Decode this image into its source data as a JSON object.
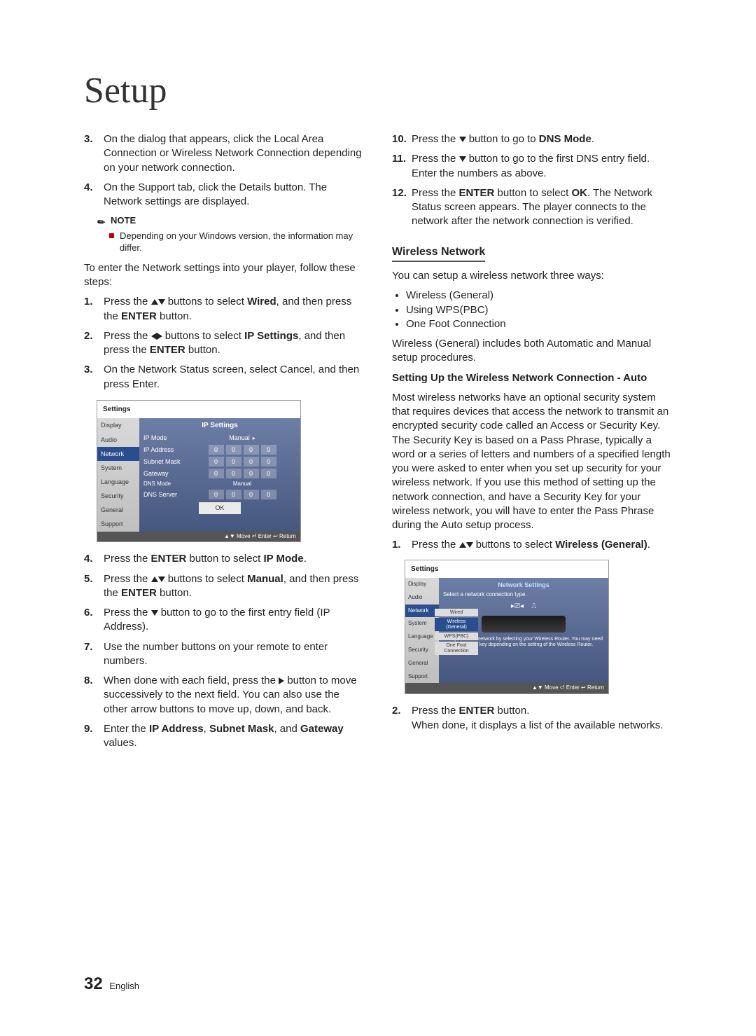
{
  "title": "Setup",
  "left": {
    "s3": "On the dialog that appears, click the Local Area Connection or Wireless Network Connection depending on your network connection.",
    "s4": "On the Support tab, click the Details button. The Network settings are displayed.",
    "noteLabel": "NOTE",
    "noteText": "Depending on your Windows version, the information may differ.",
    "intro": "To enter the Network settings into your player, follow these steps:",
    "st1a": "Press the ",
    "st1b": " buttons to select ",
    "st1c": ", and then press the ",
    "st1d": " button.",
    "wired": "Wired",
    "enter": "ENTER",
    "st2a": "Press the ",
    "st2b": " buttons to select ",
    "st2c": ", and then press the ",
    "st2d": " button.",
    "ipSettings": "IP Settings",
    "st3": "On the Network Status screen, select Cancel, and then press Enter.",
    "shot": {
      "title": "Settings",
      "side": [
        "Display",
        "Audio",
        "Network",
        "System",
        "Language",
        "Security",
        "General",
        "Support"
      ],
      "panelTitle": "IP Settings",
      "rows": {
        "ipMode": "IP Mode",
        "manual": "Manual",
        "ipAddr": "IP Address",
        "subnet": "Subnet Mask",
        "gateway": "Gateway",
        "dnsMode": "DNS Mode",
        "dnsServer": "DNS Server"
      },
      "ok": "OK",
      "hint": "▲▼ Move   ⏎ Enter   ↩ Return"
    },
    "st4a": "Press the ",
    "st4b": " button to select ",
    "st4c": ".",
    "ipMode": "IP Mode",
    "st5a": "Press the ",
    "st5b": " buttons to select ",
    "st5c": ", and then press the ",
    "st5d": " button.",
    "manual": "Manual",
    "st6a": "Press the ",
    "st6b": " button to go to the first entry field (IP Address).",
    "st7": "Use the number buttons on your remote to enter numbers.",
    "st8a": "When done with each field, press the ",
    "st8b": " button to move successively to the next field. You can also use the other arrow buttons to move up, down, and back.",
    "st9a": "Enter the ",
    "st9b": ", ",
    "st9c": ", and ",
    "st9d": " values.",
    "ipAddress": "IP Address",
    "subnetMask": "Subnet Mask",
    "gateway": "Gateway"
  },
  "right": {
    "st10a": "Press the ",
    "st10b": " button to go to ",
    "st10c": ".",
    "dnsMode": "DNS Mode",
    "st11a": "Press the ",
    "st11b": " button to go to the first DNS entry field. Enter the numbers as above.",
    "st12a": "Press the ",
    "st12b": " button to select ",
    "st12c": ". The Network Status screen appears. The player connects to the network after the network connection is verified.",
    "ok": "OK",
    "enter": "ENTER",
    "h3": "Wireless Network",
    "wIntro": "You can setup a wireless network three ways:",
    "wList": [
      "Wireless (General)",
      "Using WPS(PBC)",
      "One Foot Connection"
    ],
    "wPara": "Wireless (General) includes both Automatic and Manual setup procedures.",
    "setupHdr": "Setting Up the Wireless Network Connection - Auto",
    "autoPara": "Most wireless networks have an optional security system that requires devices that access the network to transmit an encrypted security code called an Access or Security Key. The Security Key is based on a Pass Phrase, typically a word or a series of letters and numbers of a specified length you were asked to enter when you set up security for your wireless network. If you use this method of setting up the network connection, and have a Security Key for your wireless network, you will have to enter the Pass Phrase during the Auto setup process.",
    "r1a": "Press the ",
    "r1b": " buttons to select ",
    "r1c": ".",
    "wirelessGeneral": "Wireless (General)",
    "shot2": {
      "title": "Settings",
      "side": [
        "Display",
        "Audio",
        "Network",
        "System",
        "Language",
        "Security",
        "General",
        "Support"
      ],
      "panelTitle": "Network Settings",
      "prompt": "Select a network connection type.",
      "opts": [
        "Wired",
        "Wireless (General)",
        "WPS(PBC)",
        "One Foot Connection"
      ],
      "desc": "Set up wireless network by selecting your Wireless Router. You may need to enter security key depending on the setting of the Wireless Router.",
      "hint": "▲▼ Move   ⏎ Enter   ↩ Return"
    },
    "r2a": "Press the ",
    "r2b": " button.",
    "r2c": "When done, it displays a list of the available networks."
  },
  "footer": {
    "page": "32",
    "lang": "English"
  }
}
